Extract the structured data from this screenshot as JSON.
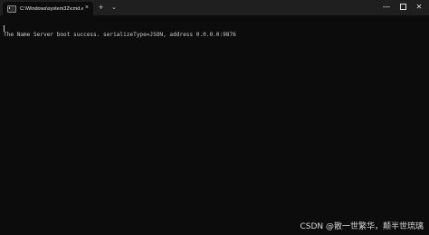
{
  "window": {
    "tab_title": "C:\\Windows\\system32\\cmd.e",
    "tab_close": "×",
    "new_tab": "+",
    "tab_dropdown": "⌄",
    "minimize": "—",
    "close": "✕"
  },
  "console": {
    "lines": [
      "The Name Server boot success. serializeType=JSON, address 0.0.0.0:9876"
    ]
  },
  "watermark": "CSDN @散一世繁华，颠半世琉璃"
}
